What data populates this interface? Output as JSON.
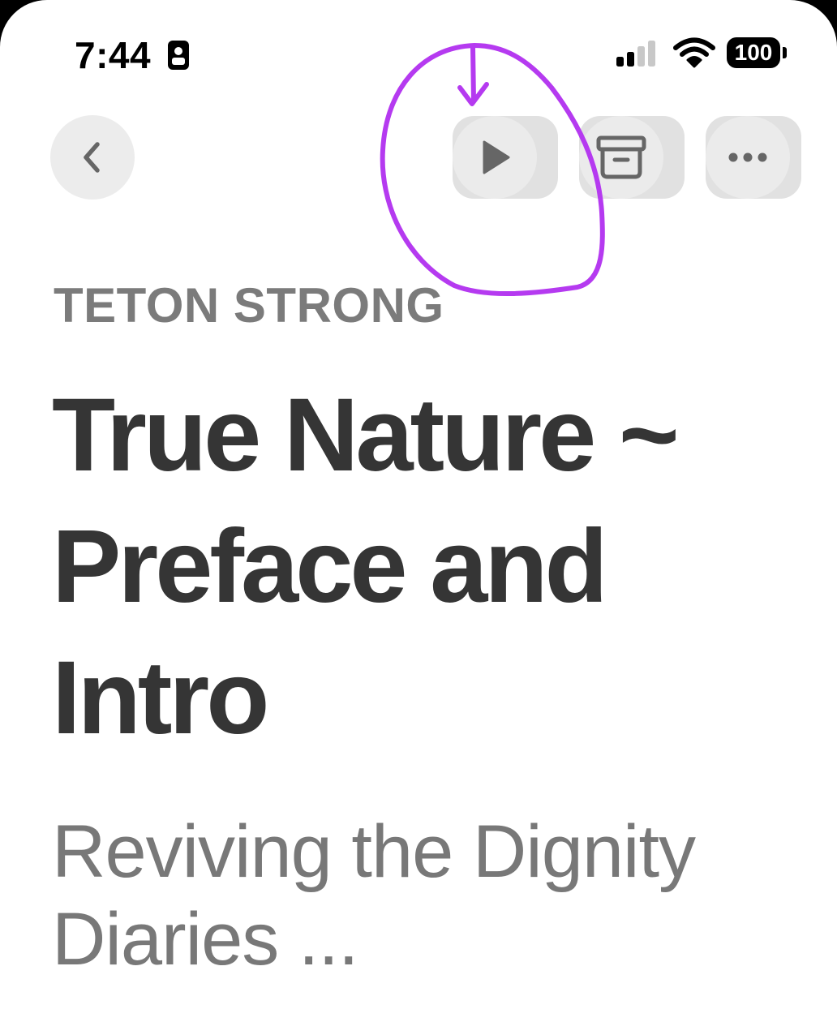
{
  "status_bar": {
    "time": "7:44",
    "battery": "100"
  },
  "toolbar": {
    "back_icon": "chevron-left-icon",
    "play_icon": "play-icon",
    "archive_icon": "archive-box-icon",
    "more_icon": "ellipsis-icon"
  },
  "article": {
    "publication": "TETON STRONG",
    "title": "True Nature ~ Preface and Intro",
    "subtitle": "Reviving the Dignity Diaries ..."
  },
  "annotation": {
    "color": "#b53af0",
    "shape": "hand-drawn circle with arrow pointing down at play button"
  },
  "colors": {
    "background": "#ffffff",
    "button_bg": "#e1e1e1",
    "icon": "#666666",
    "title": "#353535",
    "publication": "#7b7b7b",
    "subtitle": "#787878"
  }
}
